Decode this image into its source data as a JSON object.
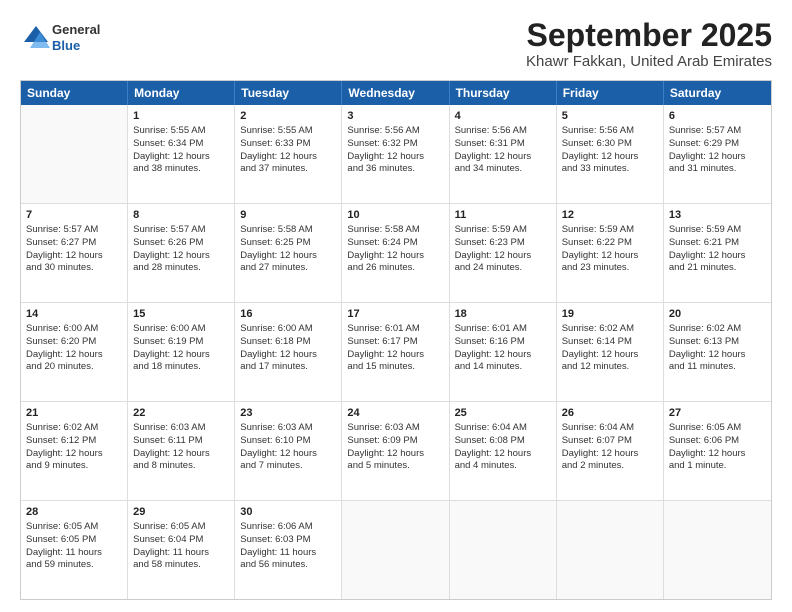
{
  "title": "September 2025",
  "subtitle": "Khawr Fakkan, United Arab Emirates",
  "logo": {
    "line1": "General",
    "line2": "Blue"
  },
  "weekdays": [
    "Sunday",
    "Monday",
    "Tuesday",
    "Wednesday",
    "Thursday",
    "Friday",
    "Saturday"
  ],
  "weeks": [
    [
      {
        "day": "",
        "lines": []
      },
      {
        "day": "1",
        "lines": [
          "Sunrise: 5:55 AM",
          "Sunset: 6:34 PM",
          "Daylight: 12 hours",
          "and 38 minutes."
        ]
      },
      {
        "day": "2",
        "lines": [
          "Sunrise: 5:55 AM",
          "Sunset: 6:33 PM",
          "Daylight: 12 hours",
          "and 37 minutes."
        ]
      },
      {
        "day": "3",
        "lines": [
          "Sunrise: 5:56 AM",
          "Sunset: 6:32 PM",
          "Daylight: 12 hours",
          "and 36 minutes."
        ]
      },
      {
        "day": "4",
        "lines": [
          "Sunrise: 5:56 AM",
          "Sunset: 6:31 PM",
          "Daylight: 12 hours",
          "and 34 minutes."
        ]
      },
      {
        "day": "5",
        "lines": [
          "Sunrise: 5:56 AM",
          "Sunset: 6:30 PM",
          "Daylight: 12 hours",
          "and 33 minutes."
        ]
      },
      {
        "day": "6",
        "lines": [
          "Sunrise: 5:57 AM",
          "Sunset: 6:29 PM",
          "Daylight: 12 hours",
          "and 31 minutes."
        ]
      }
    ],
    [
      {
        "day": "7",
        "lines": [
          "Sunrise: 5:57 AM",
          "Sunset: 6:27 PM",
          "Daylight: 12 hours",
          "and 30 minutes."
        ]
      },
      {
        "day": "8",
        "lines": [
          "Sunrise: 5:57 AM",
          "Sunset: 6:26 PM",
          "Daylight: 12 hours",
          "and 28 minutes."
        ]
      },
      {
        "day": "9",
        "lines": [
          "Sunrise: 5:58 AM",
          "Sunset: 6:25 PM",
          "Daylight: 12 hours",
          "and 27 minutes."
        ]
      },
      {
        "day": "10",
        "lines": [
          "Sunrise: 5:58 AM",
          "Sunset: 6:24 PM",
          "Daylight: 12 hours",
          "and 26 minutes."
        ]
      },
      {
        "day": "11",
        "lines": [
          "Sunrise: 5:59 AM",
          "Sunset: 6:23 PM",
          "Daylight: 12 hours",
          "and 24 minutes."
        ]
      },
      {
        "day": "12",
        "lines": [
          "Sunrise: 5:59 AM",
          "Sunset: 6:22 PM",
          "Daylight: 12 hours",
          "and 23 minutes."
        ]
      },
      {
        "day": "13",
        "lines": [
          "Sunrise: 5:59 AM",
          "Sunset: 6:21 PM",
          "Daylight: 12 hours",
          "and 21 minutes."
        ]
      }
    ],
    [
      {
        "day": "14",
        "lines": [
          "Sunrise: 6:00 AM",
          "Sunset: 6:20 PM",
          "Daylight: 12 hours",
          "and 20 minutes."
        ]
      },
      {
        "day": "15",
        "lines": [
          "Sunrise: 6:00 AM",
          "Sunset: 6:19 PM",
          "Daylight: 12 hours",
          "and 18 minutes."
        ]
      },
      {
        "day": "16",
        "lines": [
          "Sunrise: 6:00 AM",
          "Sunset: 6:18 PM",
          "Daylight: 12 hours",
          "and 17 minutes."
        ]
      },
      {
        "day": "17",
        "lines": [
          "Sunrise: 6:01 AM",
          "Sunset: 6:17 PM",
          "Daylight: 12 hours",
          "and 15 minutes."
        ]
      },
      {
        "day": "18",
        "lines": [
          "Sunrise: 6:01 AM",
          "Sunset: 6:16 PM",
          "Daylight: 12 hours",
          "and 14 minutes."
        ]
      },
      {
        "day": "19",
        "lines": [
          "Sunrise: 6:02 AM",
          "Sunset: 6:14 PM",
          "Daylight: 12 hours",
          "and 12 minutes."
        ]
      },
      {
        "day": "20",
        "lines": [
          "Sunrise: 6:02 AM",
          "Sunset: 6:13 PM",
          "Daylight: 12 hours",
          "and 11 minutes."
        ]
      }
    ],
    [
      {
        "day": "21",
        "lines": [
          "Sunrise: 6:02 AM",
          "Sunset: 6:12 PM",
          "Daylight: 12 hours",
          "and 9 minutes."
        ]
      },
      {
        "day": "22",
        "lines": [
          "Sunrise: 6:03 AM",
          "Sunset: 6:11 PM",
          "Daylight: 12 hours",
          "and 8 minutes."
        ]
      },
      {
        "day": "23",
        "lines": [
          "Sunrise: 6:03 AM",
          "Sunset: 6:10 PM",
          "Daylight: 12 hours",
          "and 7 minutes."
        ]
      },
      {
        "day": "24",
        "lines": [
          "Sunrise: 6:03 AM",
          "Sunset: 6:09 PM",
          "Daylight: 12 hours",
          "and 5 minutes."
        ]
      },
      {
        "day": "25",
        "lines": [
          "Sunrise: 6:04 AM",
          "Sunset: 6:08 PM",
          "Daylight: 12 hours",
          "and 4 minutes."
        ]
      },
      {
        "day": "26",
        "lines": [
          "Sunrise: 6:04 AM",
          "Sunset: 6:07 PM",
          "Daylight: 12 hours",
          "and 2 minutes."
        ]
      },
      {
        "day": "27",
        "lines": [
          "Sunrise: 6:05 AM",
          "Sunset: 6:06 PM",
          "Daylight: 12 hours",
          "and 1 minute."
        ]
      }
    ],
    [
      {
        "day": "28",
        "lines": [
          "Sunrise: 6:05 AM",
          "Sunset: 6:05 PM",
          "Daylight: 11 hours",
          "and 59 minutes."
        ]
      },
      {
        "day": "29",
        "lines": [
          "Sunrise: 6:05 AM",
          "Sunset: 6:04 PM",
          "Daylight: 11 hours",
          "and 58 minutes."
        ]
      },
      {
        "day": "30",
        "lines": [
          "Sunrise: 6:06 AM",
          "Sunset: 6:03 PM",
          "Daylight: 11 hours",
          "and 56 minutes."
        ]
      },
      {
        "day": "",
        "lines": []
      },
      {
        "day": "",
        "lines": []
      },
      {
        "day": "",
        "lines": []
      },
      {
        "day": "",
        "lines": []
      }
    ]
  ]
}
